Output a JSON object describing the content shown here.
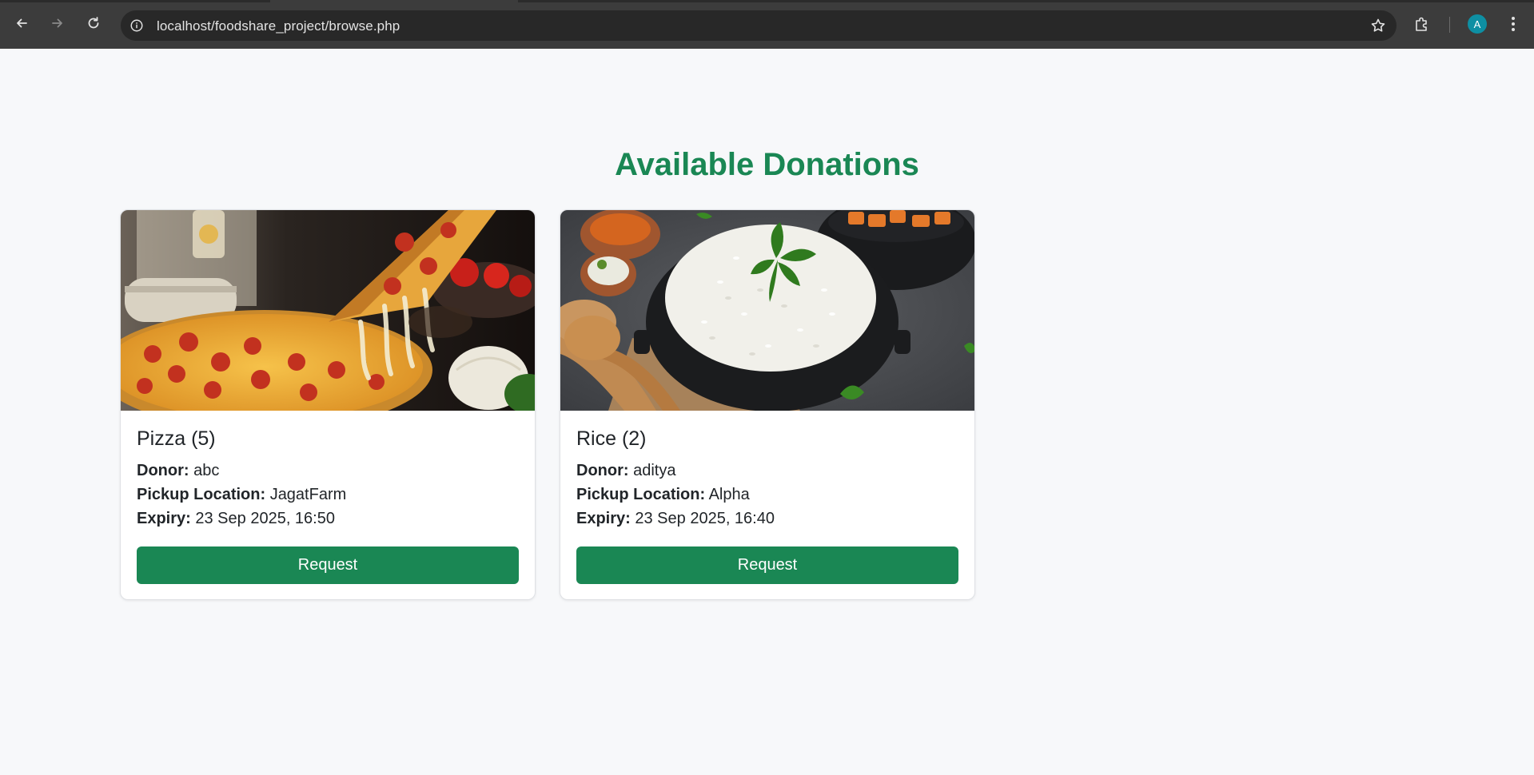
{
  "browser": {
    "url": "localhost/foodshare_project/browse.php",
    "avatar_letter": "A",
    "icons": {
      "back": "arrow-left-icon",
      "forward": "arrow-right-icon",
      "reload": "reload-icon",
      "site_info": "info-icon",
      "bookmark": "star-icon",
      "extensions": "puzzle-icon",
      "menu": "kebab-menu-icon"
    }
  },
  "page": {
    "heading": "Available Donations",
    "accent_color": "#1a8754",
    "donations": [
      {
        "title": "Pizza (5)",
        "donor_label": "Donor:",
        "donor": "abc",
        "location_label": "Pickup Location:",
        "location": "JagatFarm",
        "expiry_label": "Expiry:",
        "expiry": "23 Sep 2025, 16:50",
        "button": "Request",
        "image": "pizza-photo"
      },
      {
        "title": "Rice (2)",
        "donor_label": "Donor:",
        "donor": "aditya",
        "location_label": "Pickup Location:",
        "location": "Alpha",
        "expiry_label": "Expiry:",
        "expiry": "23 Sep 2025, 16:40",
        "button": "Request",
        "image": "rice-photo"
      }
    ]
  }
}
